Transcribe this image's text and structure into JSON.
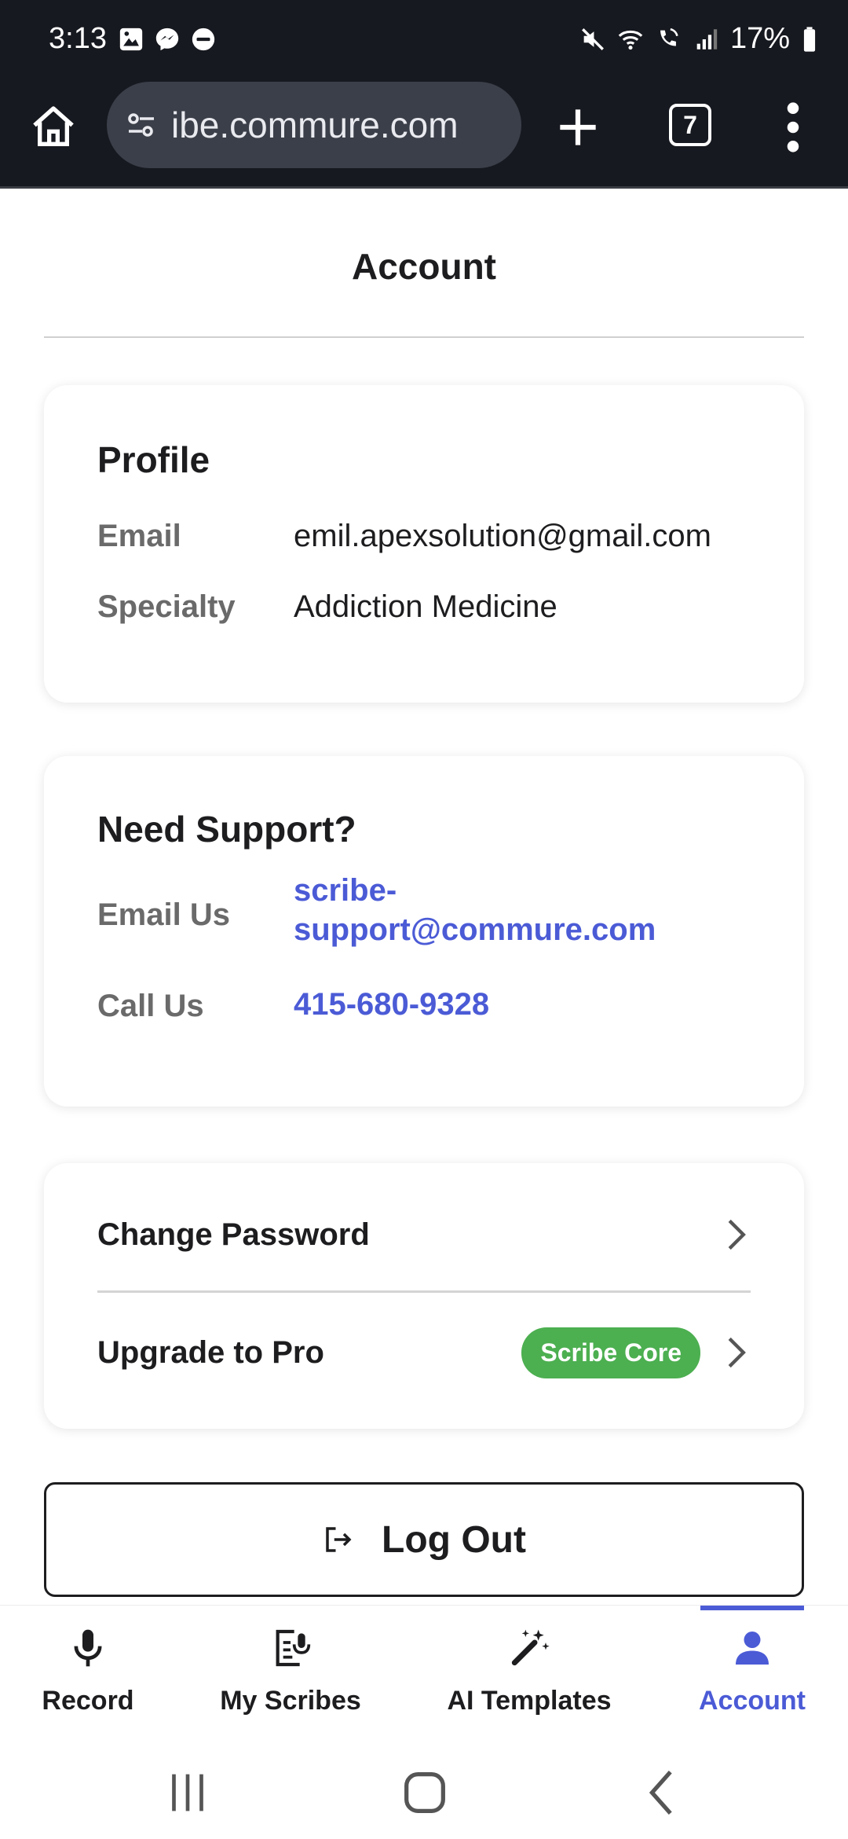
{
  "status_bar": {
    "time": "3:13",
    "battery": "17%",
    "left_icons": [
      "gallery-icon",
      "messenger-icon",
      "do-not-disturb-icon"
    ],
    "right_icons": [
      "mute-icon",
      "wifi-icon",
      "wifi-calling-icon",
      "signal-icon",
      "battery-icon"
    ]
  },
  "browser": {
    "url": "ibe.commure.com",
    "tab_count": "7"
  },
  "page": {
    "title": "Account"
  },
  "profile": {
    "heading": "Profile",
    "email_label": "Email",
    "email_value": "emil.apexsolution@gmail.com",
    "specialty_label": "Specialty",
    "specialty_value": "Addiction Medicine"
  },
  "support": {
    "heading": "Need Support?",
    "email_label": "Email Us",
    "email_value_line1": "scribe-",
    "email_value_line2": "support@commure.com",
    "call_label": "Call Us",
    "call_value": "415-680-9328"
  },
  "actions": {
    "change_password": "Change Password",
    "upgrade": "Upgrade to Pro",
    "plan_badge": "Scribe Core"
  },
  "logout": {
    "label": "Log Out"
  },
  "bottom_nav": {
    "items": [
      {
        "label": "Record",
        "icon": "microphone-icon"
      },
      {
        "label": "My Scribes",
        "icon": "document-mic-icon"
      },
      {
        "label": "AI Templates",
        "icon": "magic-wand-icon"
      },
      {
        "label": "Account",
        "icon": "person-icon",
        "active": true
      }
    ]
  },
  "colors": {
    "accent": "#4b5bd6",
    "badge_green": "#4caf50",
    "status_bar_bg": "#171920"
  }
}
